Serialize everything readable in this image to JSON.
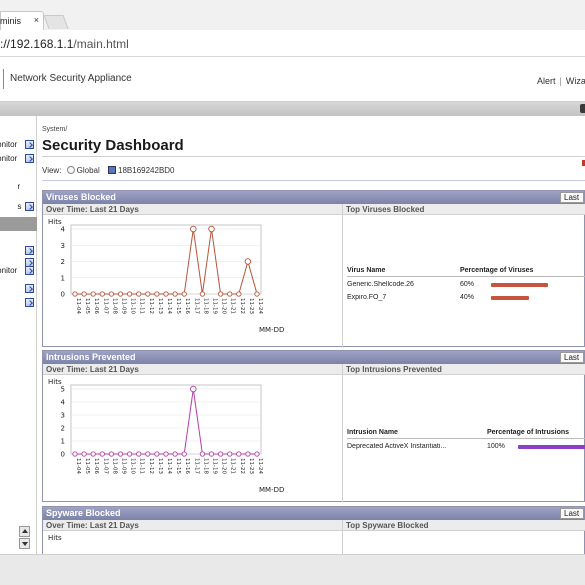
{
  "browser": {
    "tab_title": "Administrator",
    "tab_close": "×",
    "url_scheme": "https",
    "url_host": "://192.168.1.1",
    "url_path": "/main.html"
  },
  "header": {
    "title": "Network Security Appliance",
    "links": [
      "Alert",
      "Wizards"
    ],
    "separator": "|"
  },
  "sidebar": {
    "items": [
      {
        "label": "Monitor",
        "icon": true
      },
      {
        "label": "Monitor",
        "icon": true
      },
      {
        "label": "",
        "icon": false
      },
      {
        "label": "r",
        "icon": false
      },
      {
        "label": "s",
        "icon": true
      },
      {
        "label": "",
        "icon": false,
        "selected": true
      },
      {
        "label": "",
        "icon": true
      },
      {
        "label": "",
        "icon": true
      },
      {
        "label": "Monitor",
        "icon": true
      },
      {
        "label": "",
        "icon": true
      },
      {
        "label": "",
        "icon": true
      }
    ]
  },
  "main": {
    "breadcrumb": "System/",
    "title": "Security Dashboard",
    "view_label": "View:",
    "view_global": "Global",
    "view_device": "18B169242BD0"
  },
  "panels": [
    {
      "title": "Viruses Blocked",
      "range": "Last",
      "left_sub": "Over Time: Last 21 Days",
      "right_sub": "Top Viruses Blocked",
      "col_name": "Virus Name",
      "col_pct": "Percentage of Viruses",
      "rows": [
        {
          "name": "Generic.Shellcode.26",
          "pct_text": "60%",
          "pct": 0.6
        },
        {
          "name": "Expiro.FO_7",
          "pct_text": "40%",
          "pct": 0.4
        }
      ],
      "bar_color": "#c8543d"
    },
    {
      "title": "Intrusions Prevented",
      "range": "Last",
      "left_sub": "Over Time: Last 21 Days",
      "right_sub": "Top Intrusions Prevented",
      "col_name": "Intrusion Name",
      "col_pct": "Percentage of Intrusions",
      "rows": [
        {
          "name": "Deprecated ActiveX Instantiati...",
          "pct_text": "100%",
          "pct": 1.0
        }
      ],
      "bar_color": "#8a3fc4"
    },
    {
      "title": "Spyware Blocked",
      "range": "Last",
      "left_sub": "Over Time: Last 21 Days",
      "right_sub": "Top Spyware Blocked"
    }
  ],
  "chart_data": [
    {
      "type": "line",
      "ylabel": "Hits",
      "xlabel": "MM-DD",
      "ylim": [
        0,
        4
      ],
      "yticks": [
        0,
        1,
        2,
        3,
        4
      ],
      "x": [
        "11-04",
        "11-05",
        "11-06",
        "11-07",
        "11-08",
        "11-09",
        "11-10",
        "11-11",
        "11-12",
        "11-13",
        "11-14",
        "11-15",
        "11-16",
        "11-17",
        "11-18",
        "11-19",
        "11-20",
        "11-21",
        "11-22",
        "11-23",
        "11-24"
      ],
      "series": [
        {
          "values": [
            0,
            0,
            0,
            0,
            0,
            0,
            0,
            0,
            0,
            0,
            0,
            0,
            0,
            4,
            0,
            4,
            0,
            0,
            0,
            2,
            0
          ],
          "color": "#b5553c"
        }
      ]
    },
    {
      "type": "line",
      "ylabel": "Hits",
      "xlabel": "MM-DD",
      "ylim": [
        0,
        5
      ],
      "yticks": [
        0,
        1,
        2,
        3,
        4,
        5
      ],
      "x": [
        "11-04",
        "11-05",
        "11-06",
        "11-07",
        "11-08",
        "11-09",
        "11-10",
        "11-11",
        "11-12",
        "11-13",
        "11-14",
        "11-15",
        "11-16",
        "11-17",
        "11-18",
        "11-19",
        "11-20",
        "11-21",
        "11-22",
        "11-23",
        "11-24"
      ],
      "series": [
        {
          "values": [
            0,
            0,
            0,
            0,
            0,
            0,
            0,
            0,
            0,
            0,
            0,
            0,
            0,
            5,
            0,
            0,
            0,
            0,
            0,
            0,
            0
          ],
          "color": "#b43fa8"
        }
      ]
    },
    {
      "type": "line",
      "ylabel": "Hits"
    }
  ]
}
